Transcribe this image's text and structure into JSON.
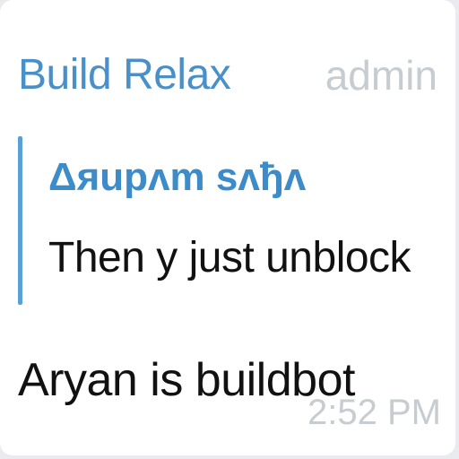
{
  "message": {
    "sender_name": "Build Relax",
    "sender_role": "admin",
    "reply": {
      "author": "Δяupʌm sʌђʌ",
      "text": "Then y just unblock"
    },
    "text": "Aryan is buildbot",
    "time": "2:52 PM"
  },
  "colors": {
    "accent": "#4a90c8",
    "reply_bar": "#5a9fd6",
    "muted": "#c7ccd1",
    "text": "#111111",
    "background": "#ffffff"
  }
}
